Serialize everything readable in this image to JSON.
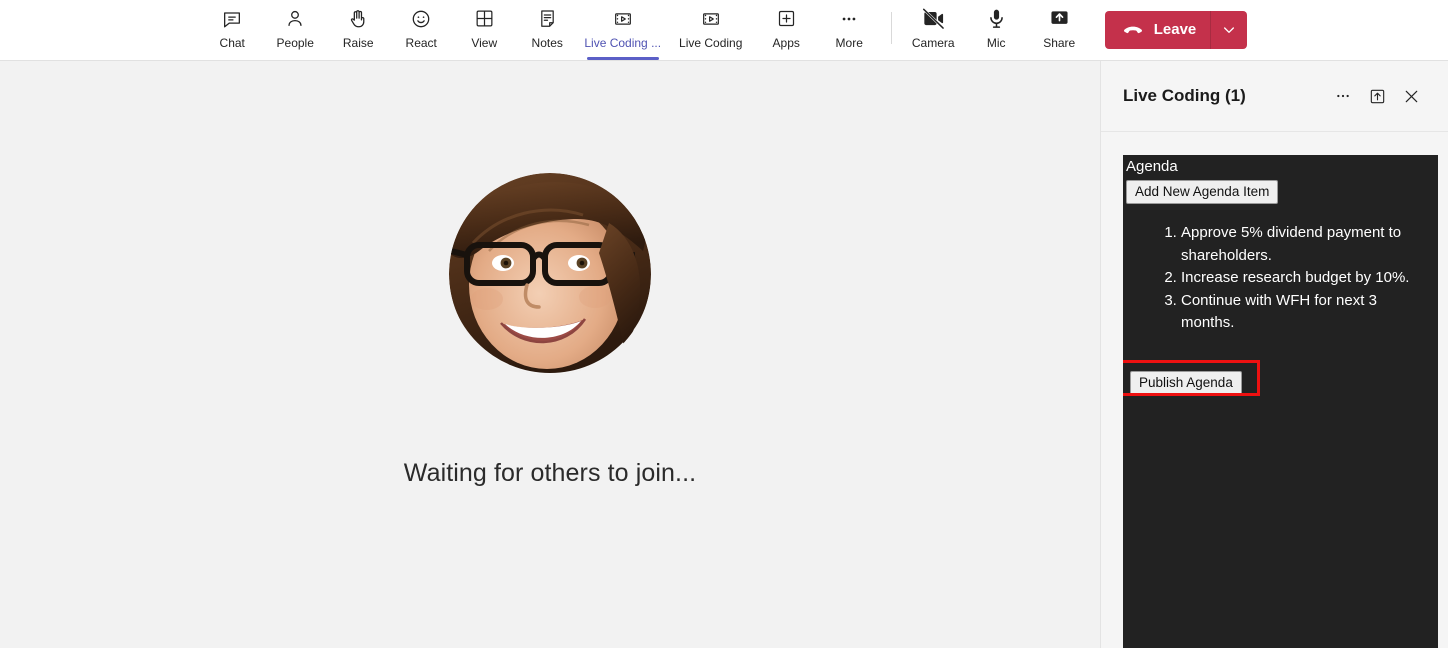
{
  "toolbar": {
    "items": [
      {
        "label": "Chat",
        "icon": "chat-icon",
        "active": false
      },
      {
        "label": "People",
        "icon": "people-icon",
        "active": false
      },
      {
        "label": "Raise",
        "icon": "raise-hand-icon",
        "active": false
      },
      {
        "label": "React",
        "icon": "react-smiley-icon",
        "active": false
      },
      {
        "label": "View",
        "icon": "view-grid-icon",
        "active": false
      },
      {
        "label": "Notes",
        "icon": "notes-icon",
        "active": false
      },
      {
        "label": "Live Coding ...",
        "icon": "live-coding-icon",
        "active": true
      },
      {
        "label": "Live Coding",
        "icon": "live-coding-icon",
        "active": false
      },
      {
        "label": "Apps",
        "icon": "apps-plus-icon",
        "active": false
      },
      {
        "label": "More",
        "icon": "more-ellipsis-icon",
        "active": false
      }
    ],
    "call_controls": [
      {
        "label": "Camera",
        "icon": "camera-off-icon"
      },
      {
        "label": "Mic",
        "icon": "microphone-icon"
      },
      {
        "label": "Share",
        "icon": "share-up-arrow-icon"
      }
    ],
    "leave": {
      "label": "Leave",
      "icon": "hangup-phone-icon",
      "caret_icon": "chevron-down-icon",
      "color": "#c4314b"
    },
    "active_underline_color": "#5b5fc7"
  },
  "stage": {
    "avatar_name": "participant-avatar",
    "message": "Waiting for others to join..."
  },
  "panel": {
    "title": "Live Coding (1)",
    "actions": [
      {
        "name": "more-options-icon",
        "icon": "ellipsis-icon"
      },
      {
        "name": "popout-icon",
        "icon": "popout-box-arrow-icon"
      },
      {
        "name": "close-panel-icon",
        "icon": "close-x-icon"
      }
    ],
    "app": {
      "heading": "Agenda",
      "add_button": "Add New Agenda Item",
      "items": [
        "Approve 5% dividend payment to shareholders.",
        "Increase research budget by 10%.",
        "Continue with WFH for next 3 months."
      ],
      "publish_button": "Publish Agenda",
      "highlight_color": "#ee1111",
      "background_color": "#222222"
    }
  }
}
